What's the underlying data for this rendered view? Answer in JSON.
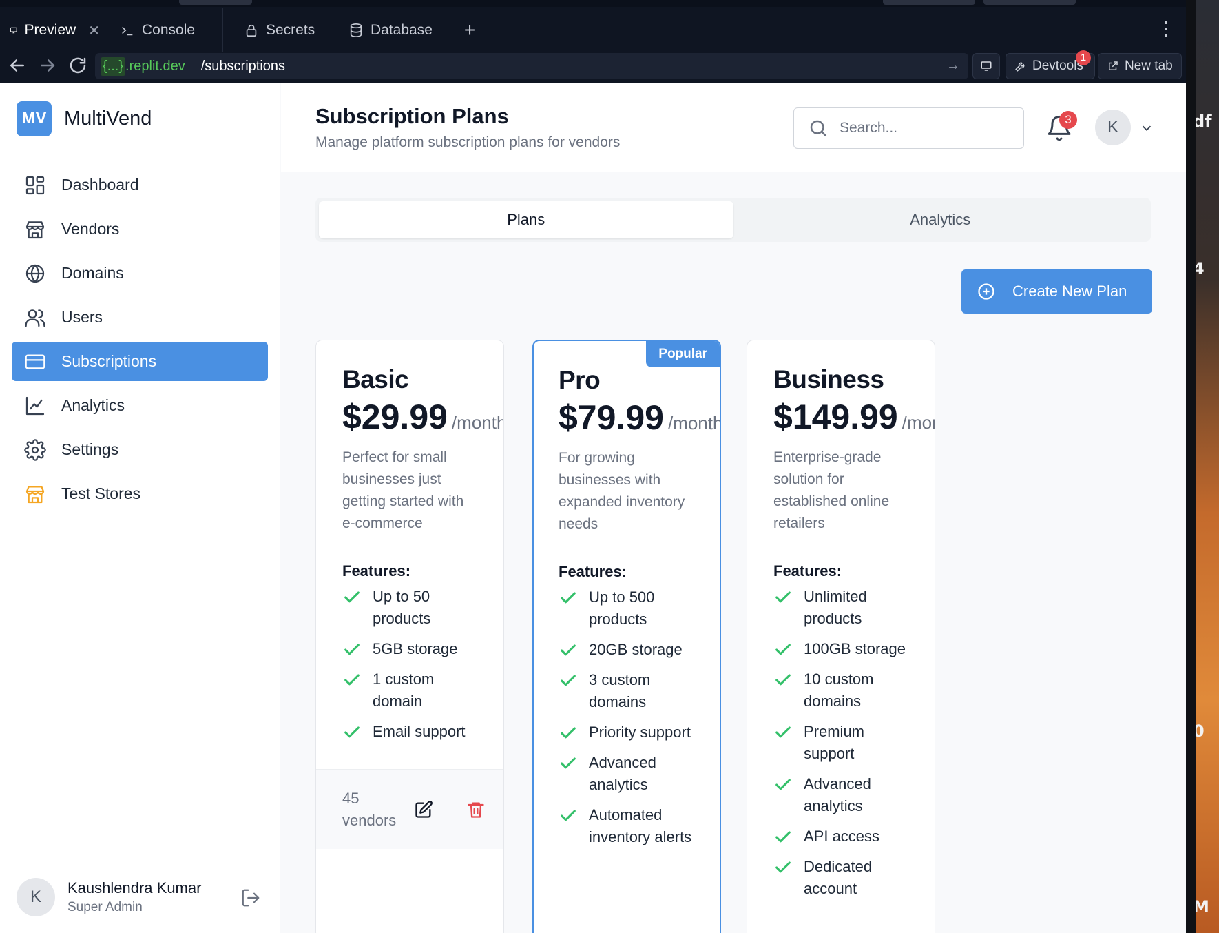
{
  "browser": {
    "tabs": [
      {
        "label": "Preview",
        "icon": "monitor-icon",
        "active": true,
        "closable": true
      },
      {
        "label": "Console",
        "icon": "terminal-icon"
      },
      {
        "label": "Secrets",
        "icon": "lock-icon"
      },
      {
        "label": "Database",
        "icon": "database-icon"
      }
    ],
    "add_tab": "+",
    "more": "⋮",
    "url_host_braces": "{...}",
    "url_host_domain": ".replit.dev",
    "url_path": "/subscriptions",
    "devtools_label": "Devtools",
    "devtools_badge": "1",
    "new_tab_label": "New tab"
  },
  "desktop_fragments": [
    "df",
    "4",
    "0",
    "M"
  ],
  "sidebar": {
    "logo_text": "MV",
    "brand": "MultiVend",
    "items": [
      {
        "label": "Dashboard",
        "icon": "dashboard-icon"
      },
      {
        "label": "Vendors",
        "icon": "store-icon"
      },
      {
        "label": "Domains",
        "icon": "globe-icon"
      },
      {
        "label": "Users",
        "icon": "users-icon"
      },
      {
        "label": "Subscriptions",
        "icon": "credit-card-icon",
        "active": true
      },
      {
        "label": "Analytics",
        "icon": "line-chart-icon"
      },
      {
        "label": "Settings",
        "icon": "gear-icon"
      },
      {
        "label": "Test Stores",
        "icon": "store-icon",
        "accent": "#f5a623"
      }
    ],
    "user": {
      "initial": "K",
      "name": "Kaushlendra Kumar",
      "role": "Super Admin"
    }
  },
  "header": {
    "title": "Subscription Plans",
    "subtitle": "Manage platform subscription plans for vendors",
    "search_placeholder": "Search...",
    "notifications_count": "3",
    "avatar_initial": "K"
  },
  "tabs": [
    {
      "label": "Plans",
      "active": true
    },
    {
      "label": "Analytics"
    }
  ],
  "create_button": "Create New Plan",
  "plans": [
    {
      "name": "Basic",
      "price": "$29.99",
      "period": "/month",
      "description": "Perfect for small businesses just getting started with e-commerce",
      "features_title": "Features:",
      "features": [
        "Up to 50 products",
        "5GB storage",
        "1 custom domain",
        "Email support"
      ],
      "vendors": "45 vendors"
    },
    {
      "name": "Pro",
      "badge": "Popular",
      "price": "$79.99",
      "period": "/month",
      "description": "For growing businesses with expanded inventory needs",
      "features_title": "Features:",
      "features": [
        "Up to 500 products",
        "20GB storage",
        "3 custom domains",
        "Priority support",
        "Advanced analytics",
        "Automated inventory alerts"
      ]
    },
    {
      "name": "Business",
      "price": "$149.99",
      "period": "/month",
      "description": "Enterprise-grade solution for established online retailers",
      "features_title": "Features:",
      "features": [
        "Unlimited products",
        "100GB storage",
        "10 custom domains",
        "Premium support",
        "Advanced analytics",
        "API access",
        "Dedicated account"
      ]
    }
  ],
  "colors": {
    "primary": "#4a90e2",
    "success_check": "#34c06a",
    "danger": "#e5484d",
    "accent_orange": "#f5a623"
  }
}
